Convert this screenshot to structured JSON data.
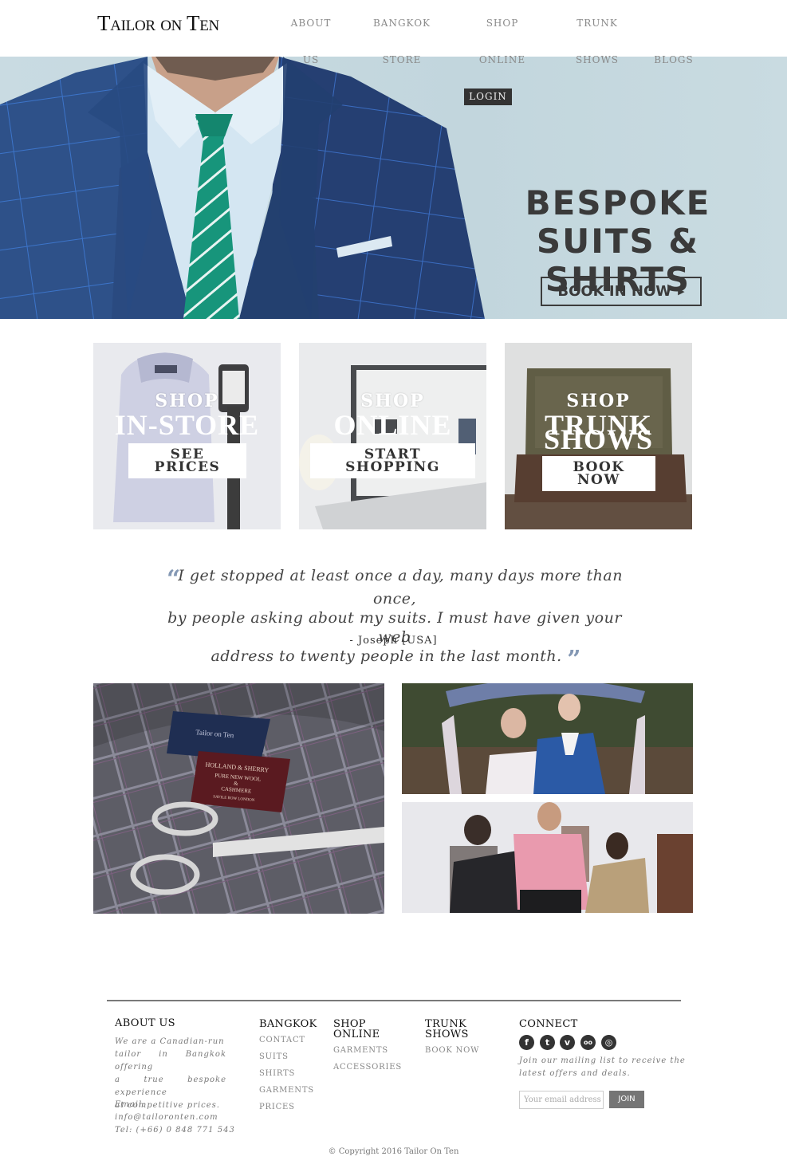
{
  "header": {
    "logo": "Tailor on Ten",
    "nav": [
      {
        "line1": "ABOUT",
        "line2": "US"
      },
      {
        "line1": "BANGKOK",
        "line2": "STORE"
      },
      {
        "line1": "SHOP",
        "line2": "ONLINE"
      },
      {
        "line1": "TRUNK",
        "line2": "SHOWS"
      },
      {
        "line1": "",
        "line2": "BLOGS"
      }
    ],
    "login_label": "LOGIN"
  },
  "hero": {
    "title_line1": "BESPOKE",
    "title_line2": "SUITS & SHIRTS",
    "cta_label": "BOOK IN NOW",
    "cta_icon": "play-arrow-icon",
    "colors": {
      "background": "#c5d8df",
      "suit": "#2d4f86",
      "tie": "#1a9a7e",
      "text": "#3a3a3a"
    }
  },
  "tiles": [
    {
      "kicker": "SHOP",
      "title": "IN-STORE",
      "button_line1": "SEE",
      "button_line2": "PRICES"
    },
    {
      "kicker": "SHOP",
      "title": "ONLINE",
      "button_line1": "START",
      "button_line2": "SHOPPING"
    },
    {
      "kicker": "SHOP",
      "title_line1": "TRUNK",
      "title_line2": "SHOWS",
      "button_line1": "BOOK",
      "button_line2": "NOW"
    }
  ],
  "testimonial": {
    "open_quote": "“",
    "close_quote": "”",
    "line1": "I get stopped at least once a day, many days more than once,",
    "line2": "by people asking about my suits. I must have given your web",
    "line3": "address to twenty people in the last month.",
    "author": "- Joseph [USA]",
    "quote_color": "#8498b4"
  },
  "gallery": [
    {
      "alt": "fabric-with-labels-and-scissors",
      "label_blue": "Tailor on Ten",
      "label_red_1": "HOLLAND & SHERRY",
      "label_red_2": "PURE NEW WOOL",
      "label_red_3": "&",
      "label_red_4": "CASHMERE",
      "label_red_5": "SAVILE ROW LONDON"
    },
    {
      "alt": "wedding-couple"
    },
    {
      "alt": "tailor-fitting"
    }
  ],
  "footer": {
    "about": {
      "heading": "ABOUT US",
      "description_1": "We are a Canadian-run",
      "description_2": "tailor in Bangkok offering",
      "description_3": "a true bespoke experience",
      "description_4": "at competitive prices.",
      "email_label": "Email:",
      "email": "info@tailoronten.com",
      "tel": "Tel: (+66) 0 848 771 543"
    },
    "bangkok": {
      "heading": "BANGKOK",
      "links": [
        "CONTACT",
        "SUITS",
        "SHIRTS",
        "GARMENTS",
        "PRICES"
      ]
    },
    "shop_online": {
      "heading_1": "SHOP",
      "heading_2": "ONLINE",
      "links": [
        "GARMENTS",
        "ACCESSORIES"
      ]
    },
    "trunk_shows": {
      "heading_1": "TRUNK",
      "heading_2": "SHOWS",
      "links": [
        "BOOK NOW"
      ]
    },
    "connect": {
      "heading": "CONNECT",
      "social": [
        {
          "name": "facebook-icon",
          "glyph": "f"
        },
        {
          "name": "twitter-icon",
          "glyph": "t"
        },
        {
          "name": "vimeo-icon",
          "glyph": "v"
        },
        {
          "name": "tripadvisor-icon",
          "glyph": "oo"
        },
        {
          "name": "instagram-icon",
          "glyph": "◎"
        }
      ],
      "mailing_1": "Join our mailing list to receive the",
      "mailing_2": "latest offers and deals.",
      "email_placeholder": "Your email address",
      "join_label": "JOIN"
    },
    "copyright": "© Copyright 2016 Tailor On Ten"
  }
}
